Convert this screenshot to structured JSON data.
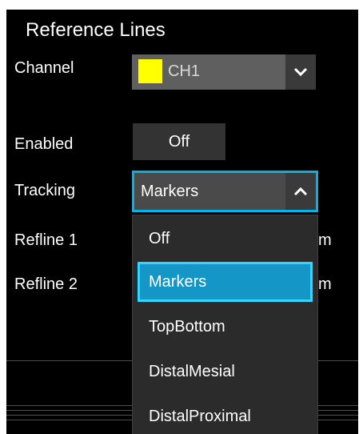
{
  "title": "Reference Lines",
  "channel": {
    "label": "Channel",
    "value": "CH1",
    "swatch_color": "#ffff00",
    "arrow_icon": "chevron-down-icon"
  },
  "enabled": {
    "label": "Enabled",
    "value": "Off"
  },
  "tracking": {
    "label": "Tracking",
    "value": "Markers",
    "arrow_icon": "chevron-up-icon",
    "options": [
      "Off",
      "Markers",
      "TopBottom",
      "DistalMesial",
      "DistalProximal"
    ],
    "selected_index": 1
  },
  "refline1": {
    "label": "Refline 1",
    "unit_partial": "m"
  },
  "refline2": {
    "label": "Refline 2",
    "unit_partial": "m"
  },
  "colors": {
    "accent": "#00b4e8",
    "selected_bg": "#1497c6"
  }
}
